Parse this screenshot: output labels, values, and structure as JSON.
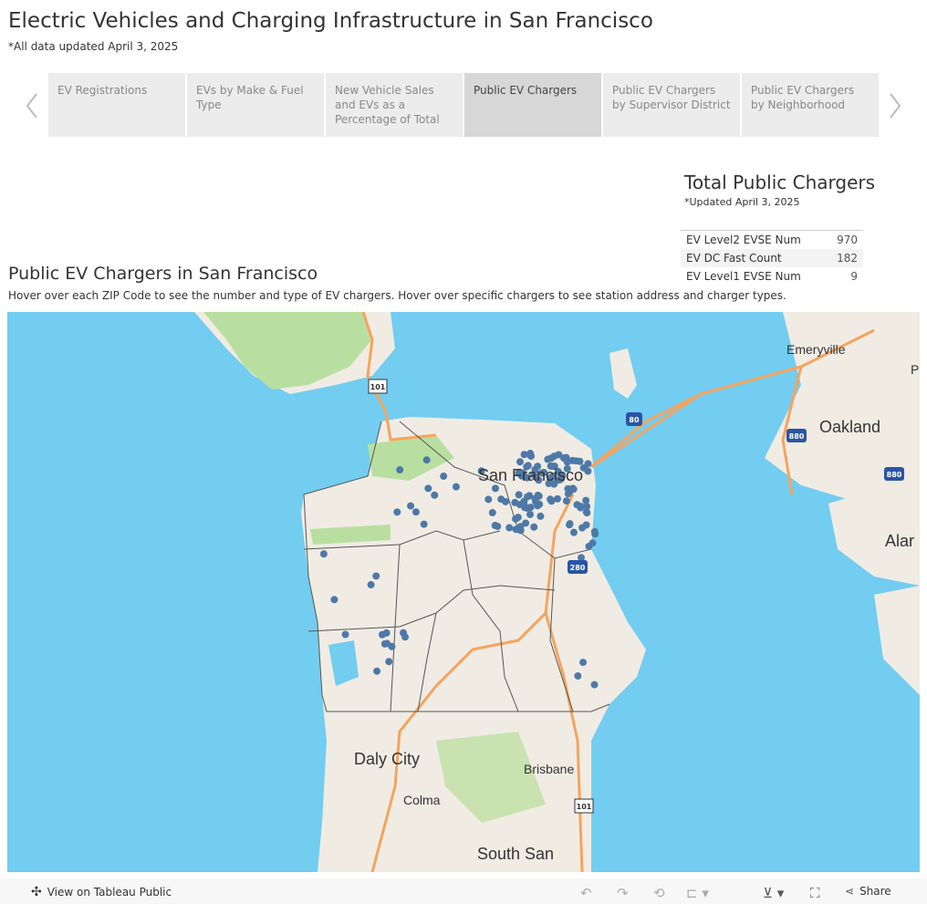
{
  "header": {
    "title": "Electric Vehicles and Charging Infrastructure in San Francisco",
    "subtitle": "*All data updated April 3, 2025"
  },
  "tabs": [
    {
      "label": "EV Registrations",
      "active": false
    },
    {
      "label": "EVs by Make & Fuel Type",
      "active": false
    },
    {
      "label": "New Vehicle Sales and EVs as a Percentage of Total",
      "active": false
    },
    {
      "label": "Public EV Chargers",
      "active": true
    },
    {
      "label": "Public EV Chargers by Supervisor District",
      "active": false
    },
    {
      "label": "Public EV Chargers by Neighborhood",
      "active": false
    }
  ],
  "totals": {
    "title": "Total Public Chargers",
    "subtitle": "*Updated April 3, 2025",
    "rows": [
      {
        "label": "EV Level2 EVSE Num",
        "value": "970"
      },
      {
        "label": "EV DC Fast Count",
        "value": "182"
      },
      {
        "label": "EV Level1 EVSE Num",
        "value": "9"
      }
    ]
  },
  "map": {
    "title": "Public EV Chargers in San Francisco",
    "description": "Hover over each ZIP Code to see the number and type of EV chargers. Hover over specific chargers to see station address and charger types.",
    "labels": {
      "emeryville": "Emeryville",
      "oakland": "Oakland",
      "alameda": "Alar",
      "sf": "San Francisco",
      "daly": "Daly City",
      "colma": "Colma",
      "brisbane": "Brisbane",
      "ssf": "South San",
      "p": "P"
    },
    "shields": {
      "us101": "101",
      "i80": "80",
      "i880": "880",
      "i280": "280",
      "us101b": "101",
      "i880b": "880"
    },
    "colors": {
      "water": "#72cdf0",
      "land": "#f0ece4",
      "park": "#b9dfa0",
      "dot": "#4e79a7",
      "highway": "#f7a35c"
    }
  },
  "toolbar": {
    "view_label": "View on Tableau Public",
    "share_label": "Share"
  }
}
